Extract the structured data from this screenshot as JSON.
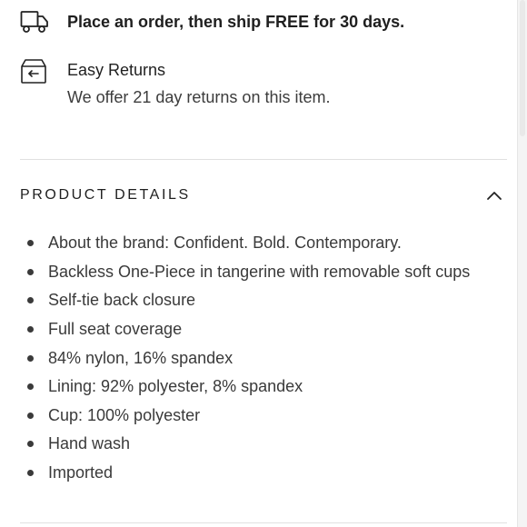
{
  "shipping": {
    "icon": "truck-icon",
    "text": "Place an order, then ship FREE for 30 days."
  },
  "returns": {
    "icon": "return-box-icon",
    "title": "Easy Returns",
    "description": "We offer 21 day returns on this item."
  },
  "product_details": {
    "title": "PRODUCT DETAILS",
    "toggle_icon": "chevron-up-icon",
    "items": [
      "About the brand: Confident. Bold. Contemporary.",
      "Backless One-Piece in tangerine with removable soft cups",
      "Self-tie back closure",
      "Full seat coverage",
      "84% nylon, 16% spandex",
      "Lining: 92% polyester, 8% spandex",
      "Cup: 100% polyester",
      "Hand wash",
      "Imported"
    ]
  }
}
